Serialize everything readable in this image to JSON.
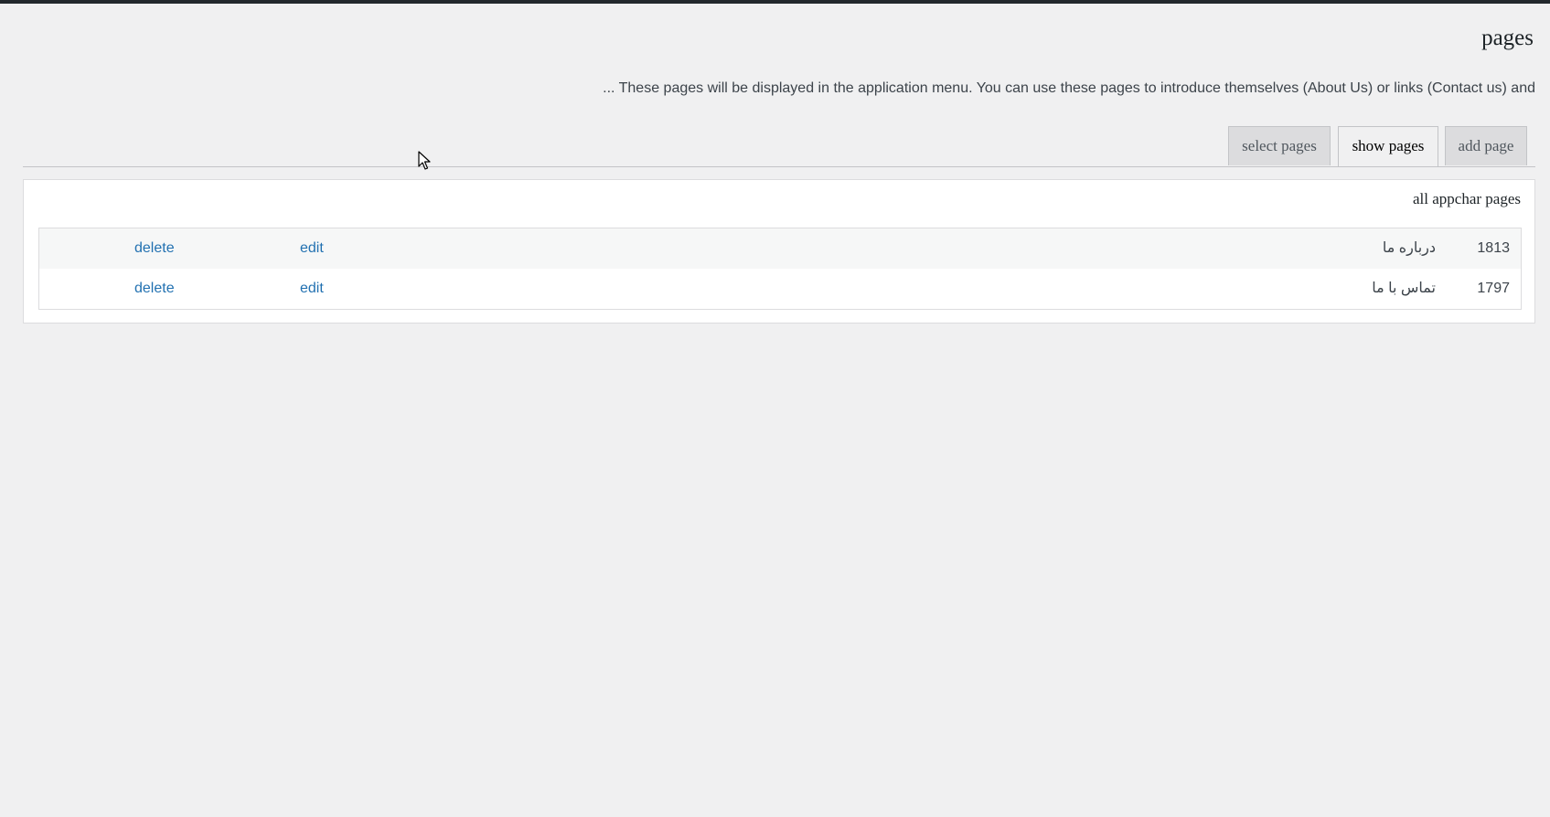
{
  "header": {
    "title": "pages",
    "description": "... These pages will be displayed in the application menu. You can use these pages to introduce themselves (About Us) or links (Contact us) and"
  },
  "tabs": [
    {
      "label": "add page",
      "active": false
    },
    {
      "label": "show pages",
      "active": true
    },
    {
      "label": "select pages",
      "active": false
    }
  ],
  "panel": {
    "title": "all appchar pages",
    "rows": [
      {
        "id": "1813",
        "title": "درباره ما",
        "edit_label": "edit",
        "delete_label": "delete"
      },
      {
        "id": "1797",
        "title": "تماس با ما",
        "edit_label": "edit",
        "delete_label": "delete"
      }
    ]
  },
  "colors": {
    "topbar": "#23282d",
    "background": "#f0f0f1",
    "link": "#2271b1"
  },
  "icons": {
    "cursor": "mouse-pointer-icon"
  }
}
